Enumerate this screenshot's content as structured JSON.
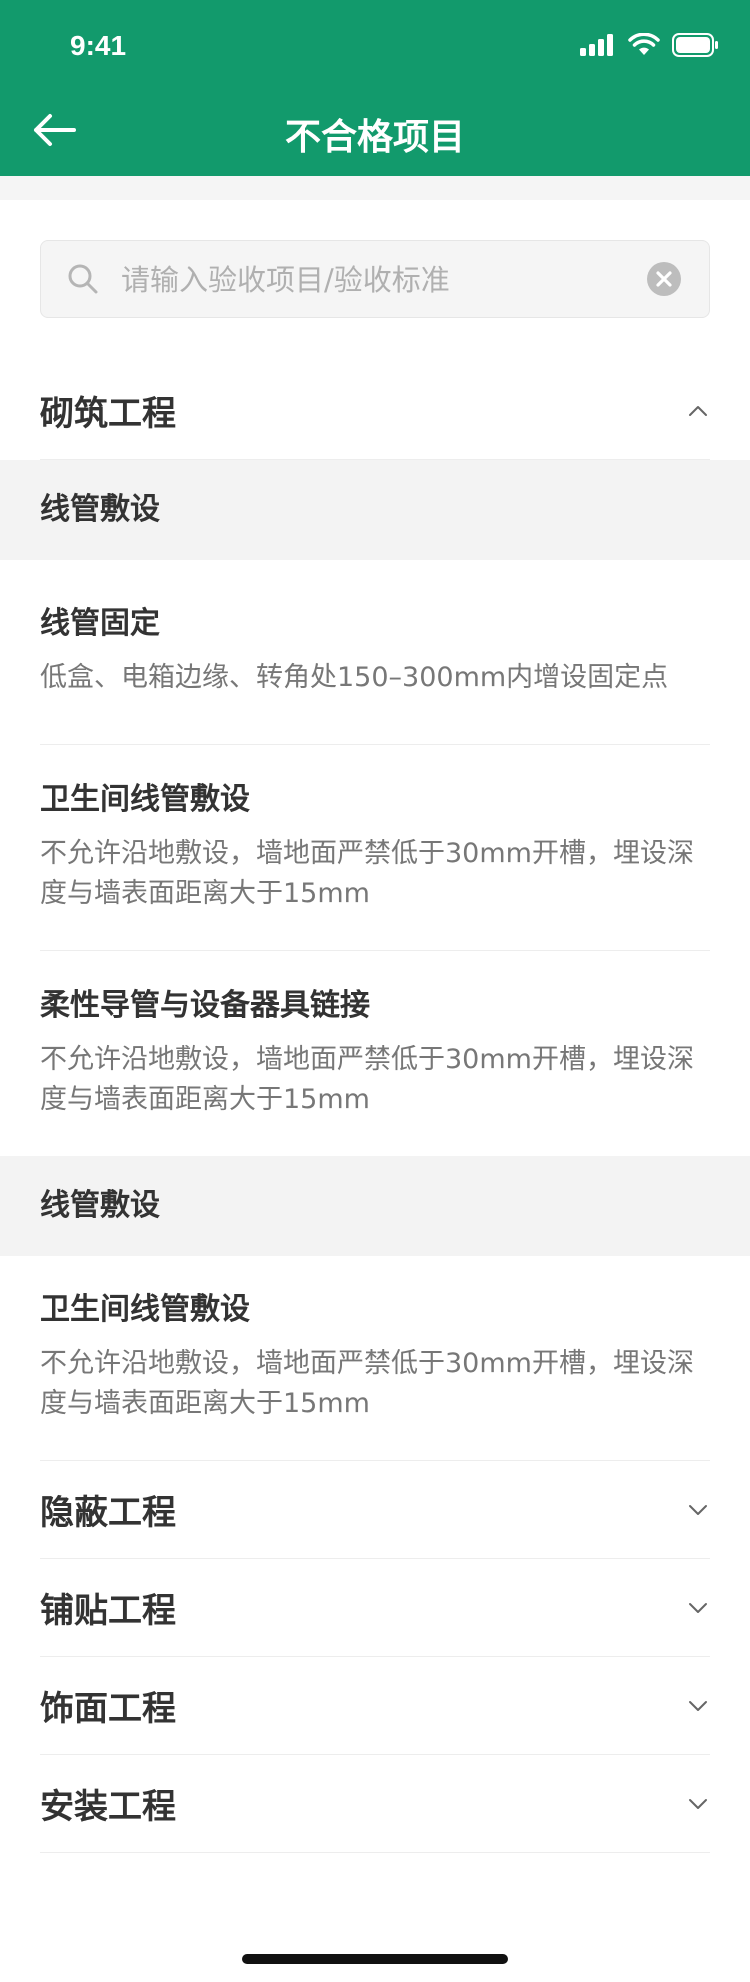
{
  "status": {
    "time": "9:41"
  },
  "nav": {
    "title": "不合格项目"
  },
  "search": {
    "placeholder": "请输入验收项目/验收标准",
    "value": ""
  },
  "sections": [
    {
      "title": "砌筑工程"
    },
    {
      "title": "隐蔽工程"
    },
    {
      "title": "铺贴工程"
    },
    {
      "title": "饰面工程"
    },
    {
      "title": "安装工程"
    }
  ],
  "groups": [
    {
      "title": "线管敷设",
      "items": [
        {
          "title": "线管固定",
          "desc": "低盒、电箱边缘、转角处150–300mm内增设固定点"
        },
        {
          "title": "卫生间线管敷设",
          "desc": "不允许沿地敷设，墙地面严禁低于30mm开槽，埋设深度与墙表面距离大于15mm"
        },
        {
          "title": "柔性导管与设备器具链接",
          "desc": "不允许沿地敷设，墙地面严禁低于30mm开槽，埋设深度与墙表面距离大于15mm"
        }
      ]
    },
    {
      "title": "线管敷设",
      "items": [
        {
          "title": "卫生间线管敷设",
          "desc": "不允许沿地敷设，墙地面严禁低于30mm开槽，埋设深度与墙表面距离大于15mm"
        }
      ]
    }
  ],
  "colors": {
    "brand": "#129A6C"
  }
}
